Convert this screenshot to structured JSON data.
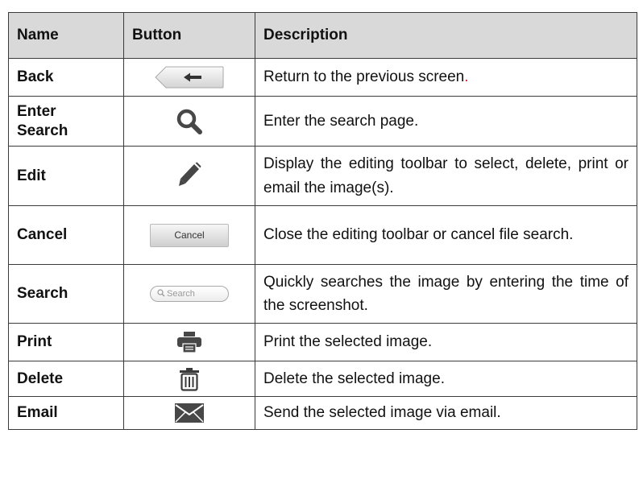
{
  "table": {
    "headers": {
      "name": "Name",
      "button": "Button",
      "description": "Description"
    },
    "rows": [
      {
        "name": "Back",
        "button_icon": "back-arrow-icon",
        "description": "Return to the previous screen",
        "description_end": "."
      },
      {
        "name_line1": "Enter",
        "name_line2": "Search",
        "button_icon": "magnifier-icon",
        "description": "Enter the search page."
      },
      {
        "name": "Edit",
        "button_icon": "pencil-icon",
        "description": "Display the editing toolbar to select, delete, print or email the image(s)."
      },
      {
        "name": "Cancel",
        "button_label": "Cancel",
        "description": "Close the editing toolbar or cancel file search."
      },
      {
        "name": "Search",
        "button_placeholder": "Search",
        "description": "Quickly searches the image by entering the time of the screenshot."
      },
      {
        "name": "Print",
        "button_icon": "printer-icon",
        "description": "Print the selected image."
      },
      {
        "name": "Delete",
        "button_icon": "trash-icon",
        "description": "Delete the selected image."
      },
      {
        "name": "Email",
        "button_icon": "envelope-icon",
        "description": "Send the selected image via email."
      }
    ]
  },
  "colors": {
    "header_bg": "#d9d9d9",
    "border": "#3a3a3a",
    "icon_gray": "#444444",
    "accent_red": "#d42020"
  }
}
